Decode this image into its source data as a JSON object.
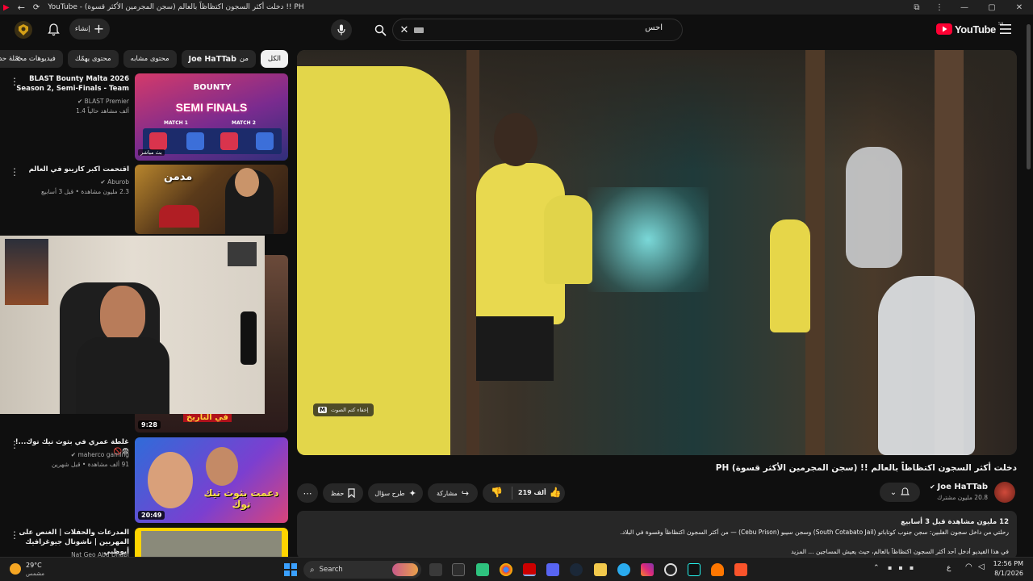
{
  "window": {
    "title": "YouTube - (سجن المجرمين الأكثر قسوة) دخلت أكثر السجون اكتظاظاً بالعالم !! PH",
    "controls": [
      "—",
      "▢",
      "✕"
    ]
  },
  "topbar": {
    "create_label": "إنشاء",
    "search_value": "احس",
    "logo_text": "YouTube",
    "logo_region": "SA"
  },
  "chips": [
    {
      "label": "الكل",
      "active": true
    },
    {
      "label": "من",
      "bold": "Joe HaTTab"
    },
    {
      "label": "محتوى مشابه"
    },
    {
      "label": "محتوى يهمّك"
    },
    {
      "label": "فيديوهات محمّلة حديثاً"
    }
  ],
  "sidebar": [
    {
      "title": "BLAST Bounty Malta 2026 Season 2, Semi-Finals - Team ...",
      "channel": "BLAST Premier",
      "verified": true,
      "stats": "1.4 ألف مشاهد حالياً",
      "live_badge": "بث مباشر",
      "thumb": {
        "brand": "BOUNTY",
        "label": "SEMI FINALS",
        "match1": "MATCH 1",
        "match2": "MATCH 2"
      }
    },
    {
      "title": "اقتحمت اكبر كازينو في العالم",
      "channel": "Aburob",
      "verified": true,
      "stats": "2.3 مليون مشاهدة • قبل 3 أسابيع",
      "thumb": {
        "overlay": "مدمن"
      }
    },
    {
      "title": "",
      "channel": "",
      "stats": "",
      "duration": "9:28",
      "thumb": {
        "overlay": "في التاريخ"
      }
    },
    {
      "title": "غلطة عمري في بثوث تيك توك...! 😨🚫",
      "channel": "maherco gaming",
      "verified": true,
      "stats": "91 ألف مشاهدة • قبل شهرين",
      "duration": "20:49",
      "thumb": {
        "overlay": "دعمت بثوث تيك توك"
      }
    },
    {
      "title": "المدرعات والحفلات | الغنص على المهربين | ناشونال جيوغرافيك أبوظبي",
      "channel": "Nat Geo Abu Dhabi",
      "verified": false,
      "stats": ""
    }
  ],
  "player": {
    "caption_hint": "إخفاء كتم الصوت",
    "caption_key": "M"
  },
  "video": {
    "title": "دخلت أكثر السجون اكتظاظاً بالعالم !! (سجن المجرمين الأكثر قسوة) PH",
    "channel": "Joe HaTTab",
    "subscribers": "20.8 مليون مشترك",
    "likes": "219 ألف",
    "share": "مشاركة",
    "ask": "طرح سؤال",
    "save": "حفظ",
    "description": {
      "stats_line": "12 مليون مشاهدة قبل 3 أسابيع",
      "line1": "رحلتي من داخل سجون الفلبين: سجن جنوب كوتاباتو (South Cotabato Jail) وسجن سيبو (Cebu Prison) — من أكثر السجون اكتظاظاً وقسوة في البلاد.",
      "line2": "في هذا الفيديو أدخل أحد أكثر السجون اكتظاظاً بالعالم، حيث يعيش المساجين ... المزيد"
    }
  },
  "taskbar": {
    "weather_temp": "29°C",
    "weather_desc": "مشمس",
    "search_placeholder": "Search",
    "lang": "ع",
    "time": "12:56 PM",
    "date": "8/1/2026"
  },
  "colors": {
    "background": "#0f0f0f",
    "chip": "#272727",
    "accent": "#ff0033",
    "text_secondary": "#aaaaaa"
  }
}
